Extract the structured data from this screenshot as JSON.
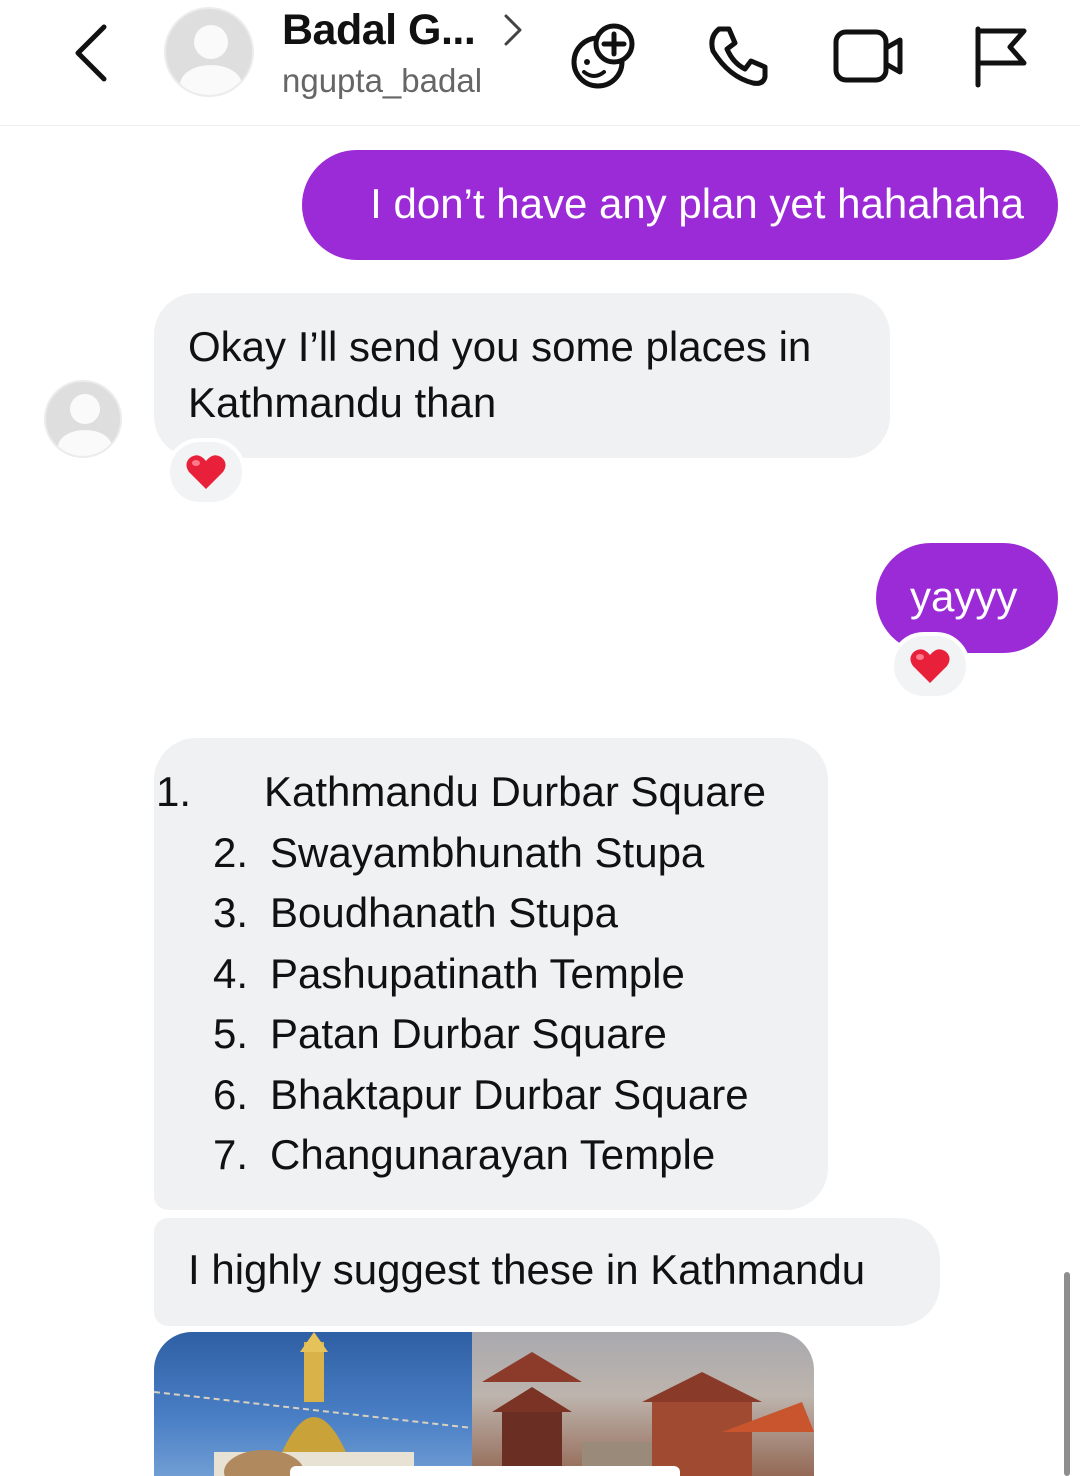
{
  "header": {
    "name": "Badal G...",
    "username": "ngupta_badal",
    "icons": [
      "back-icon",
      "chevron-right-icon",
      "effects-icon",
      "phone-icon",
      "video-icon",
      "flag-icon"
    ]
  },
  "colors": {
    "outgoing_bubble": "#9b2bd7",
    "incoming_bubble": "#f0f1f3",
    "reaction": "#e8203a"
  },
  "messages": [
    {
      "direction": "outgoing",
      "text": "I don’t have any plan yet hahahaha"
    },
    {
      "direction": "incoming",
      "text": "Okay I’ll send you some places in Kathmandu than",
      "reaction": "❤️"
    },
    {
      "direction": "outgoing",
      "text": "yayyy",
      "reaction": "❤️"
    },
    {
      "direction": "incoming",
      "list": [
        {
          "num": "1.",
          "text": "Kathmandu Durbar Square"
        },
        {
          "num": "2.",
          "text": "Swayambhunath Stupa"
        },
        {
          "num": "3.",
          "text": "Boudhanath Stupa"
        },
        {
          "num": "4.",
          "text": "Pashupatinath Temple"
        },
        {
          "num": "5.",
          "text": "Patan Durbar Square"
        },
        {
          "num": "6.",
          "text": "Bhaktapur Durbar Square"
        },
        {
          "num": "7.",
          "text": "Changunarayan Temple"
        }
      ]
    },
    {
      "direction": "incoming",
      "text": "I highly suggest these in Kathmandu"
    },
    {
      "direction": "incoming",
      "type": "image",
      "description_icon": "shared-image"
    }
  ]
}
